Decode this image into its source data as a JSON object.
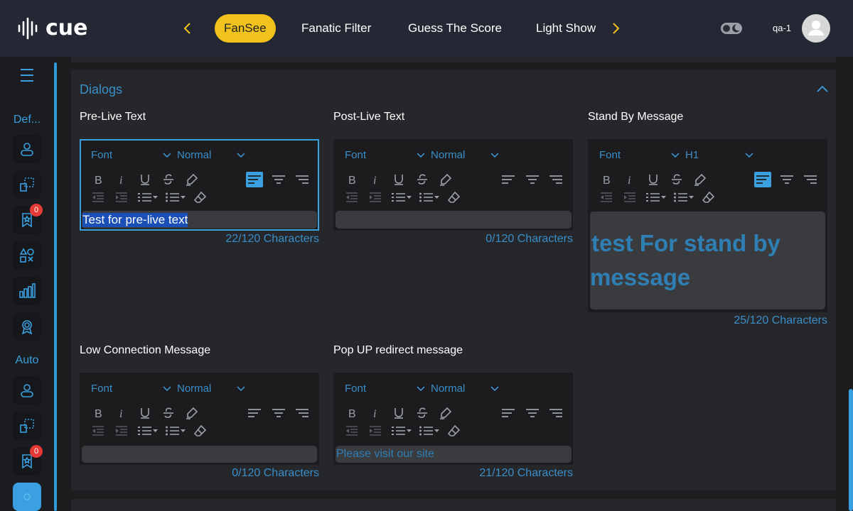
{
  "app": {
    "brand": "cue"
  },
  "nav": {
    "tabs": [
      {
        "label": "FanSee",
        "active": true
      },
      {
        "label": "Fanatic Filter"
      },
      {
        "label": "Guess The Score"
      },
      {
        "label": "Light Show"
      }
    ]
  },
  "user": {
    "name": "qa-1"
  },
  "sidebar": {
    "groups": [
      {
        "label": "Def..."
      },
      {
        "label": "Auto"
      }
    ],
    "badges": [
      "0",
      "0"
    ]
  },
  "colors": {
    "accent": "#3aa0e0",
    "active_tab": "#f1c21b",
    "badge": "#e53935",
    "topbar": "#232834"
  },
  "section": {
    "title": "Dialogs"
  },
  "editors": [
    {
      "label": "Pre-Live Text",
      "font": "Font",
      "size": "Normal",
      "text": "Test for pre-live text",
      "counter": "22/120 Characters",
      "align": "left"
    },
    {
      "label": "Post-Live Text",
      "font": "Font",
      "size": "Normal",
      "text": "",
      "counter": "0/120 Characters",
      "align": "none"
    },
    {
      "label": "Stand By Message",
      "font": "Font",
      "size": "H1",
      "text_line1": " test For stand by",
      "text_line2": "message",
      "counter": "25/120 Characters",
      "align": "left"
    },
    {
      "label": "Low Connection Message",
      "font": "Font",
      "size": "Normal",
      "text": "",
      "counter": "0/120 Characters",
      "align": "none"
    },
    {
      "label": "Pop UP redirect message",
      "font": "Font",
      "size": "Normal",
      "text": "Please visit our site",
      "counter": "21/120 Characters",
      "align": "none"
    }
  ]
}
